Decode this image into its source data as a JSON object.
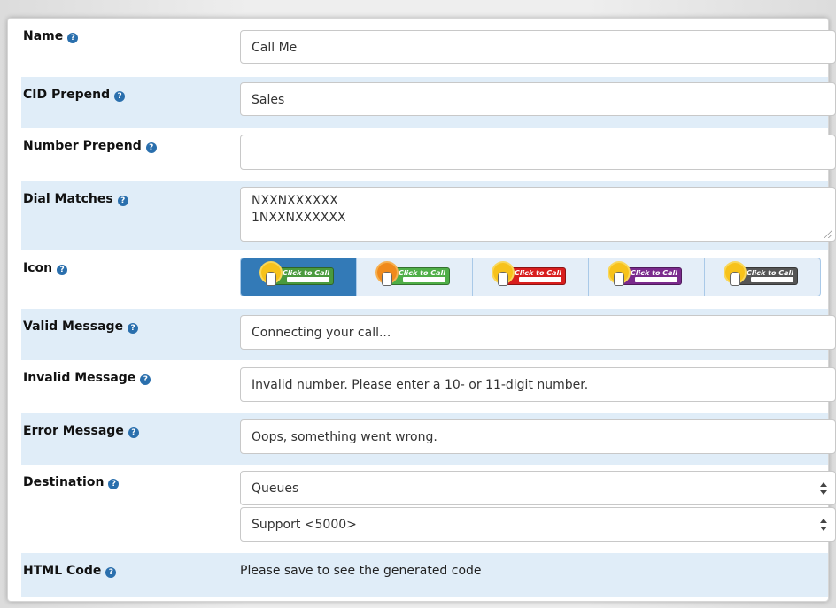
{
  "form": {
    "name": {
      "label": "Name",
      "value": "Call Me"
    },
    "cid_prepend": {
      "label": "CID Prepend",
      "value": "Sales"
    },
    "number_prepend": {
      "label": "Number Prepend",
      "value": ""
    },
    "dial_matches": {
      "label": "Dial Matches",
      "lines": [
        "NXXNXXXXXX",
        "1NXXNXXXXXX"
      ]
    },
    "icon": {
      "label": "Icon",
      "selected_index": 0,
      "options": [
        {
          "text": "Click to Call",
          "color": "#4a9a3e",
          "icon": "click-to-call-green-icon"
        },
        {
          "text": "Click to Call",
          "color": "#4fae47",
          "icon": "click-to-call-green-icon"
        },
        {
          "text": "Click to Call",
          "color": "#d81e1e",
          "icon": "click-to-call-red-icon"
        },
        {
          "text": "Click to Call",
          "color": "#7a2a8c",
          "icon": "click-to-call-purple-icon"
        },
        {
          "text": "Click to Call",
          "color": "#555555",
          "icon": "click-to-call-gray-icon"
        }
      ]
    },
    "valid_message": {
      "label": "Valid Message",
      "value": "Connecting your call..."
    },
    "invalid_message": {
      "label": "Invalid Message",
      "value": "Invalid number. Please enter a 10- or 11-digit number."
    },
    "error_message": {
      "label": "Error Message",
      "value": "Oops, something went wrong."
    },
    "destination": {
      "label": "Destination",
      "type_value": "Queues",
      "target_value": "Support <5000>"
    },
    "html_code": {
      "label": "HTML Code",
      "value": "Please save to see the generated code"
    }
  },
  "colors": {
    "row_shade": "#e0edf8",
    "help_icon": "#2a6fad",
    "active_option": "#337ab7"
  },
  "help_icon_glyph": "?"
}
